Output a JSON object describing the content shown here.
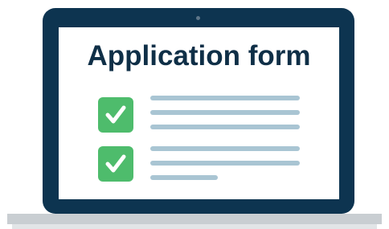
{
  "form": {
    "title": "Application form",
    "items": [
      {
        "checked": true,
        "line_count": 3
      },
      {
        "checked": true,
        "line_count": 3
      }
    ]
  },
  "colors": {
    "laptop_frame": "#0d3450",
    "screen": "#ffffff",
    "title_text": "#0f2f47",
    "checkbox": "#4ebc6c",
    "text_lines": "#a9c5d3",
    "laptop_base": "#c9ced2"
  }
}
